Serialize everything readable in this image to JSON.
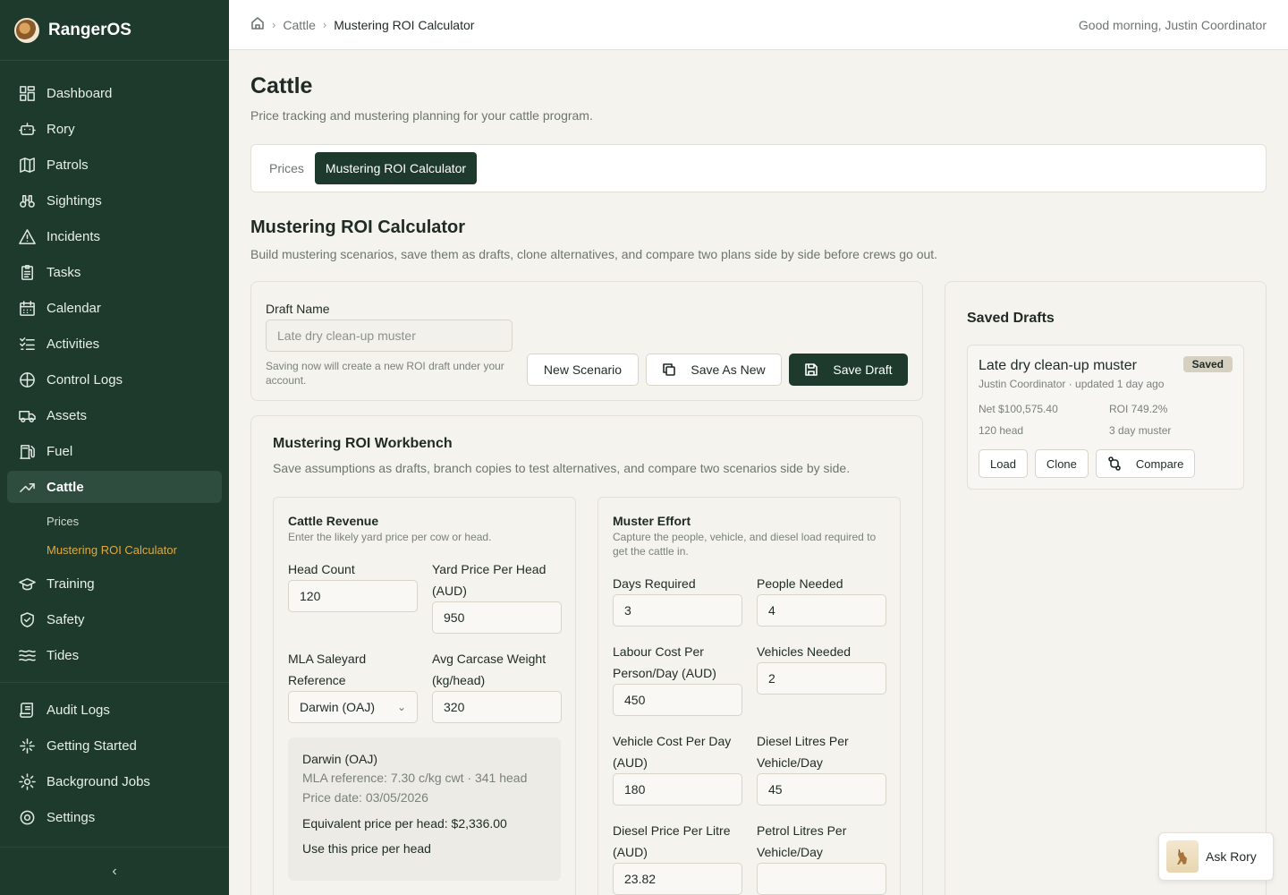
{
  "app": {
    "name": "RangerOS"
  },
  "sidebar": {
    "items": [
      {
        "label": "Dashboard",
        "icon": "dashboard-icon"
      },
      {
        "label": "Rory",
        "icon": "robot-icon"
      },
      {
        "label": "Patrols",
        "icon": "map-icon"
      },
      {
        "label": "Sightings",
        "icon": "binoculars-icon"
      },
      {
        "label": "Incidents",
        "icon": "alert-icon"
      },
      {
        "label": "Tasks",
        "icon": "clipboard-icon"
      },
      {
        "label": "Calendar",
        "icon": "calendar-icon"
      },
      {
        "label": "Activities",
        "icon": "list-check-icon"
      },
      {
        "label": "Control Logs",
        "icon": "target-icon"
      },
      {
        "label": "Assets",
        "icon": "truck-icon"
      },
      {
        "label": "Fuel",
        "icon": "fuel-icon"
      },
      {
        "label": "Cattle",
        "icon": "trend-icon",
        "active": true
      }
    ],
    "cattle_sub": [
      {
        "label": "Prices"
      },
      {
        "label": "Mustering ROI Calculator",
        "current": true
      }
    ],
    "items_after": [
      {
        "label": "Training",
        "icon": "graduation-icon"
      },
      {
        "label": "Safety",
        "icon": "shield-icon"
      },
      {
        "label": "Tides",
        "icon": "waves-icon"
      }
    ],
    "bottom_items": [
      {
        "label": "Audit Logs",
        "icon": "scroll-icon"
      },
      {
        "label": "Getting Started",
        "icon": "sparkle-icon"
      },
      {
        "label": "Background Jobs",
        "icon": "gear-icon"
      },
      {
        "label": "Settings",
        "icon": "settings-icon"
      }
    ],
    "collapse": "‹"
  },
  "topbar": {
    "breadcrumb": [
      "Cattle",
      "Mustering ROI Calculator"
    ],
    "greeting": "Good morning, Justin Coordinator"
  },
  "page": {
    "title": "Cattle",
    "subtitle": "Price tracking and mustering planning for your cattle program.",
    "tabs": [
      "Prices",
      "Mustering ROI Calculator"
    ],
    "section_title": "Mustering ROI Calculator",
    "section_sub": "Build mustering scenarios, save them as drafts, clone alternatives, and compare two plans side by side before crews go out."
  },
  "draft": {
    "label": "Draft Name",
    "placeholder": "Late dry clean-up muster",
    "hint": "Saving now will create a new ROI draft under your account.",
    "new_scenario": "New Scenario",
    "save_as_new": "Save As New",
    "save_draft": "Save Draft"
  },
  "workbench": {
    "title": "Mustering ROI Workbench",
    "subtitle": "Save assumptions as drafts, branch copies to test alternatives, and compare two scenarios side by side.",
    "revenue": {
      "title": "Cattle Revenue",
      "subtitle": "Enter the likely yard price per cow or head.",
      "head_count_label": "Head Count",
      "head_count": "120",
      "yard_price_label": "Yard Price Per Head (AUD)",
      "yard_price": "950",
      "mla_label": "MLA Saleyard Reference",
      "mla_value": "Darwin (OAJ)",
      "carcase_label": "Avg Carcase Weight (kg/head)",
      "carcase": "320",
      "ref": {
        "name": "Darwin (OAJ)",
        "reference": "MLA reference: 7.30 c/kg cwt · 341 head",
        "date": "Price date: 03/05/2026",
        "equivalent": "Equivalent price per head: $2,336.00",
        "use": "Use this price per head"
      }
    },
    "effort": {
      "title": "Muster Effort",
      "subtitle": "Capture the people, vehicle, and diesel load required to get the cattle in.",
      "days_label": "Days Required",
      "days": "3",
      "people_label": "People Needed",
      "people": "4",
      "labour_label": "Labour Cost Per Person/Day (AUD)",
      "labour": "450",
      "vehicles_label": "Vehicles Needed",
      "vehicles": "2",
      "vehicle_cost_label": "Vehicle Cost Per Day (AUD)",
      "vehicle_cost": "180",
      "diesel_litres_label": "Diesel Litres Per Vehicle/Day",
      "diesel_litres": "45",
      "diesel_price_label": "Diesel Price Per Litre (AUD)",
      "diesel_price": "23.82",
      "petrol_label": "Petrol Litres Per Vehicle/Day",
      "petrol": ""
    }
  },
  "saved": {
    "title": "Saved Drafts",
    "item": {
      "name": "Late dry clean-up muster",
      "badge": "Saved",
      "meta": "Justin Coordinator · updated 1 day ago",
      "net": "Net $100,575.40",
      "roi": "ROI 749.2%",
      "head": "120 head",
      "duration": "3 day muster",
      "load": "Load",
      "clone": "Clone",
      "compare": "Compare"
    }
  },
  "assistant": {
    "label": "Ask Rory"
  },
  "colors": {
    "sidebar": "#1d3a2c",
    "accent": "#e0a93f",
    "background": "#f5f3ee"
  }
}
